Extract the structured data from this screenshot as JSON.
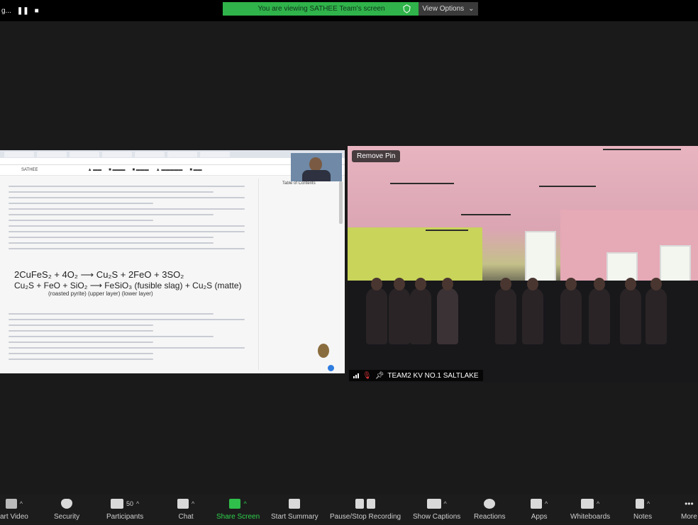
{
  "top": {
    "meeting_title": "g...",
    "banner_text": "You are viewing SATHEE Team's screen",
    "view_options_label": "View Options"
  },
  "shared_screen": {
    "site_name": "SATHEE",
    "toc_label": "Table of Contents",
    "equation_1": "2CuFeS₂ + 4O₂ ⟶ Cu₂S + 2FeO + 3SO₂",
    "equation_2": "Cu₂S + FeO + SiO₂ ⟶ FeSiO₃ (fusible slag)   +  Cu₂S (matte)",
    "equation_2_sub": "(roasted pyrite)           (upper layer)        (lower layer)"
  },
  "camera": {
    "remove_pin_label": "Remove Pin",
    "participant_name": "TEAM2 KV NO.1 SALTLAKE"
  },
  "toolbar": {
    "video_label": "art Video",
    "security_label": "Security",
    "participants_label": "Participants",
    "participants_count": "50",
    "chat_label": "Chat",
    "share_label": "Share Screen",
    "summary_label": "Start Summary",
    "recording_label": "Pause/Stop Recording",
    "captions_label": "Show Captions",
    "reactions_label": "Reactions",
    "apps_label": "Apps",
    "whiteboards_label": "Whiteboards",
    "notes_label": "Notes",
    "more_label": "More"
  },
  "colors": {
    "banner": "#2fb34a",
    "share_accent": "#2fd34d",
    "mic_muted": "#e2373b"
  }
}
